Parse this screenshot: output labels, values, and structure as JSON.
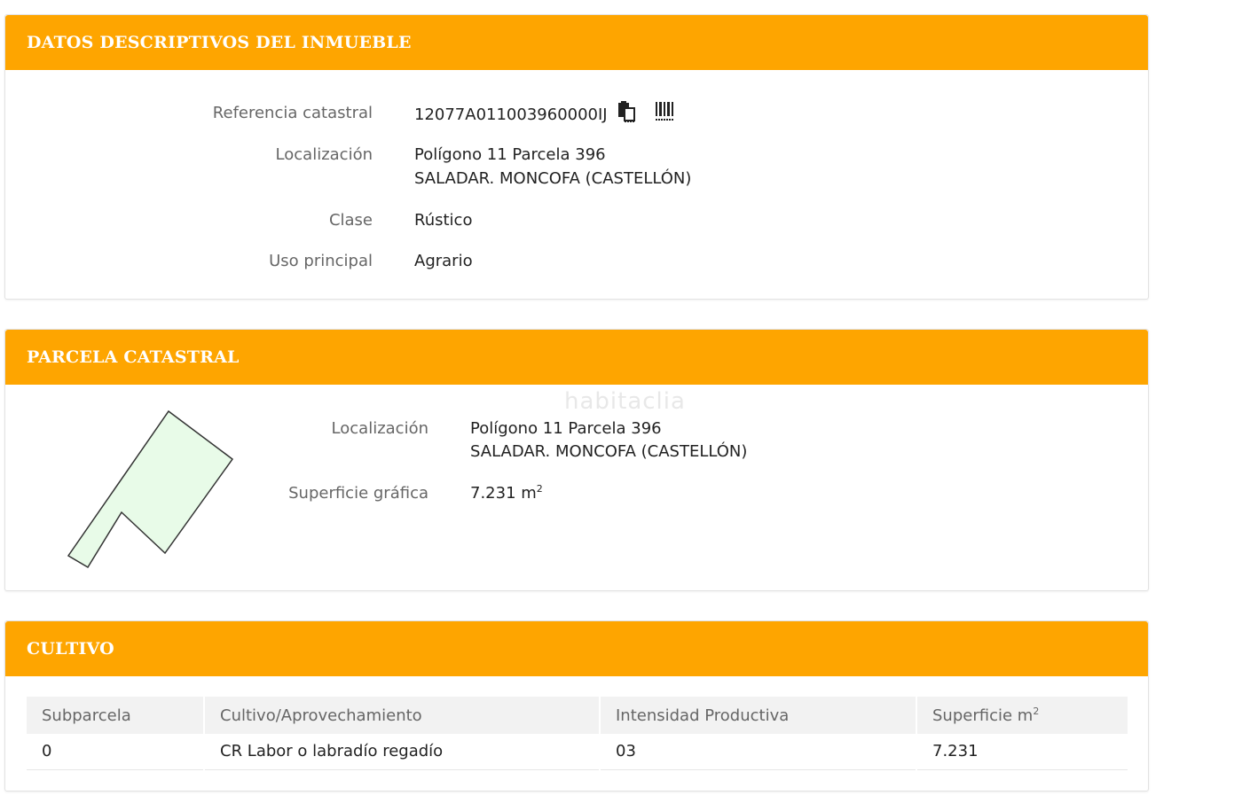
{
  "watermark": "habitaclia",
  "colors": {
    "header_bg": "#fea500",
    "header_text": "#ffffff",
    "parcel_fill": "#e8fbe8",
    "parcel_stroke": "#333333"
  },
  "panel_datos": {
    "title": "DATOS DESCRIPTIVOS DEL INMUEBLE",
    "referencia_label": "Referencia catastral",
    "referencia_value": "12077A011003960000IJ",
    "icons": [
      "copy-icon",
      "barcode-icon"
    ],
    "localizacion_label": "Localización",
    "localizacion_line1": "Polígono 11 Parcela 396",
    "localizacion_line2": "SALADAR. MONCOFA (CASTELLÓN)",
    "clase_label": "Clase",
    "clase_value": "Rústico",
    "uso_label": "Uso principal",
    "uso_value": "Agrario"
  },
  "panel_parcela": {
    "title": "PARCELA CATASTRAL",
    "localizacion_label": "Localización",
    "localizacion_line1": "Polígono 11 Parcela 396",
    "localizacion_line2": "SALADAR. MONCOFA (CASTELLÓN)",
    "superficie_label": "Superficie gráfica",
    "superficie_value": "7.231 m",
    "superficie_unit_sup": "2"
  },
  "panel_cultivo": {
    "title": "CULTIVO",
    "headers": [
      "Subparcela",
      "Cultivo/Aprovechamiento",
      "Intensidad Productiva",
      "Superficie m"
    ],
    "header_sup": "2",
    "rows": [
      [
        "0",
        "CR Labor o labradío regadío",
        "03",
        "7.231"
      ]
    ]
  }
}
